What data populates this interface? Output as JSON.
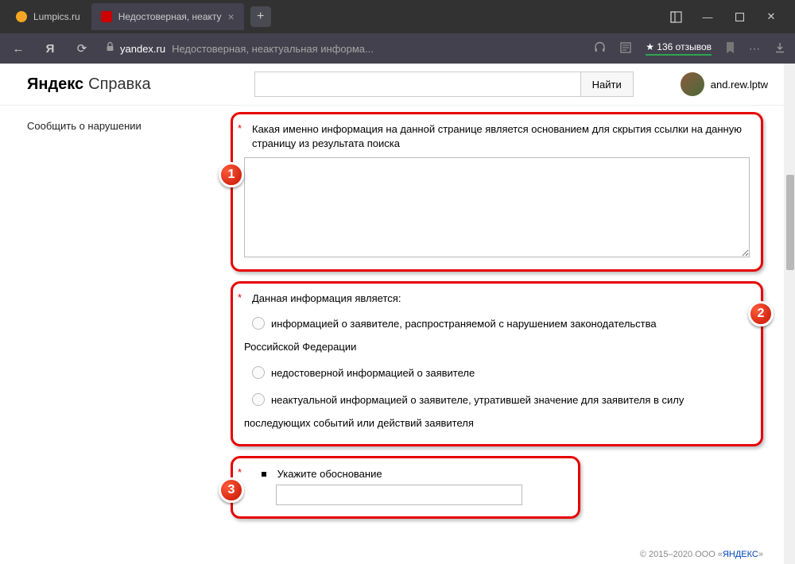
{
  "browser": {
    "tabs": [
      {
        "label": "Lumpics.ru"
      },
      {
        "label": "Недостоверная, неакту"
      }
    ],
    "url_host": "yandex.ru",
    "url_path": "Недостоверная, неактуальная информа...",
    "reviews": "★ 136 отзывов"
  },
  "header": {
    "logo_main": "Яндекс",
    "logo_sub": "Справка",
    "search_btn": "Найти",
    "username": "and.rew.lptw"
  },
  "sidebar": {
    "item1": "Сообщить о нарушении"
  },
  "form": {
    "q1_label": "Какая именно информация на данной странице является основанием для скрытия ссылки на данную страницу из результата поиска",
    "q2_label": "Данная информация является:",
    "q2_opt1": "информацией о заявителе, распространяемой с нарушением законодательства",
    "q2_opt1b": "Российской Федерации",
    "q2_opt2": "недостоверной информацией о заявителе",
    "q2_opt3": "неактуальной информацией о заявителе, утратившей значение для заявителя в силу",
    "q2_opt3b": "последующих событий или действий заявителя",
    "q3_label": "Укажите обоснование"
  },
  "badges": {
    "b1": "1",
    "b2": "2",
    "b3": "3"
  },
  "footer": {
    "copyright": "© 2015–2020  ООО «",
    "link": "ЯНДЕКС",
    "tail": "»"
  }
}
